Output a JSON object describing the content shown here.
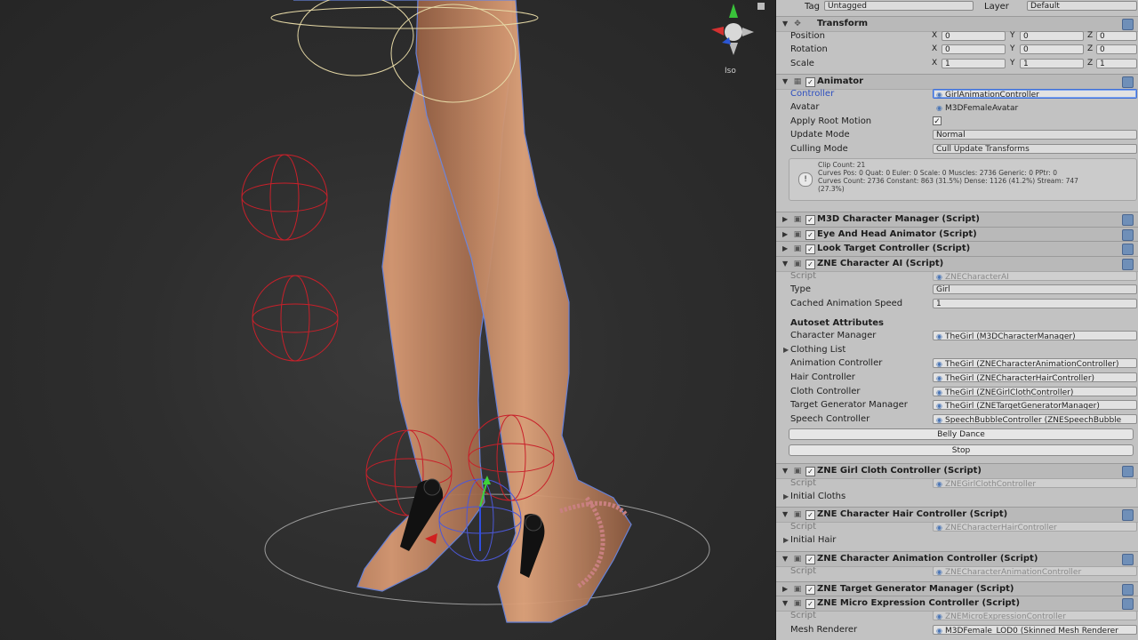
{
  "header": {
    "tag_label": "Tag",
    "tag_value": "Untagged",
    "layer_label": "Layer",
    "layer_value": "Default"
  },
  "transform": {
    "title": "Transform",
    "rows": [
      {
        "label": "Position",
        "x": "0",
        "y": "0",
        "z": "0"
      },
      {
        "label": "Rotation",
        "x": "0",
        "y": "0",
        "z": "0"
      },
      {
        "label": "Scale",
        "x": "1",
        "y": "1",
        "z": "1"
      }
    ],
    "axis_x": "X",
    "axis_y": "Y",
    "axis_z": "Z"
  },
  "animator": {
    "title": "Animator",
    "controller_label": "Controller",
    "controller_value": "GirlAnimationController",
    "avatar_label": "Avatar",
    "avatar_value": "M3DFemaleAvatar",
    "apply_root_motion_label": "Apply Root Motion",
    "update_mode_label": "Update Mode",
    "update_mode_value": "Normal",
    "culling_mode_label": "Culling Mode",
    "culling_mode_value": "Cull Update Transforms",
    "info_line1": "Clip Count: 21",
    "info_line2": "Curves Pos: 0 Quat: 0 Euler: 0 Scale: 0 Muscles: 2736 Generic: 0 PPtr: 0",
    "info_line3": "Curves Count: 2736 Constant: 863 (31.5%) Dense: 1126 (41.2%) Stream: 747",
    "info_line4": "(27.3%)"
  },
  "components": {
    "char_manager": "M3D Character Manager (Script)",
    "eye_head": "Eye And Head Animator (Script)",
    "look_target": "Look Target Controller (Script)",
    "character_ai": "ZNE Character AI (Script)"
  },
  "character_ai": {
    "script_label": "Script",
    "script_value": "ZNECharacterAI",
    "type_label": "Type",
    "type_value": "Girl",
    "cached_speed_label": "Cached Animation Speed",
    "cached_speed_value": "1",
    "autoset_title": "Autoset Attributes",
    "char_manager_label": "Character Manager",
    "char_manager_value": "TheGirl (M3DCharacterManager)",
    "clothing_list_label": "Clothing List",
    "anim_controller_label": "Animation Controller",
    "anim_controller_value": "TheGirl (ZNECharacterAnimationController)",
    "hair_controller_label": "Hair Controller",
    "hair_controller_value": "TheGirl (ZNECharacterHairController)",
    "cloth_controller_label": "Cloth Controller",
    "cloth_controller_value": "TheGirl (ZNEGirlClothController)",
    "target_gen_label": "Target Generator Manager",
    "target_gen_value": "TheGirl (ZNETargetGeneratorManager)",
    "speech_label": "Speech Controller",
    "speech_value": "SpeechBubbleController (ZNESpeechBubble",
    "belly_dance_button": "Belly Dance",
    "stop_button": "Stop"
  },
  "girl_cloth": {
    "title": "ZNE Girl Cloth Controller (Script)",
    "script_label": "Script",
    "script_value": "ZNEGirlClothController",
    "initial_label": "Initial Cloths"
  },
  "hair": {
    "title": "ZNE Character Hair Controller (Script)",
    "script_label": "Script",
    "script_value": "ZNECharacterHairController",
    "initial_label": "Initial Hair"
  },
  "anim": {
    "title": "ZNE Character Animation Controller (Script)",
    "script_label": "Script",
    "script_value": "ZNECharacterAnimationController"
  },
  "target_gen": {
    "title": "ZNE Target Generator Manager (Script)"
  },
  "micro": {
    "title": "ZNE Micro Expression Controller (Script)",
    "script_label": "Script",
    "script_value": "ZNEMicroExpressionController",
    "mesh_renderer_label": "Mesh Renderer",
    "mesh_renderer_value": "M3DFemale_LOD0 (Skinned Mesh Renderer"
  },
  "scene": {
    "gizmo_label": "Iso"
  },
  "colors": {
    "inspector_bg": "#c2c2c2",
    "selection_blue": "#2d4fbf",
    "collider_red": "#c8202a",
    "selection_outline": "#6a86e0"
  }
}
